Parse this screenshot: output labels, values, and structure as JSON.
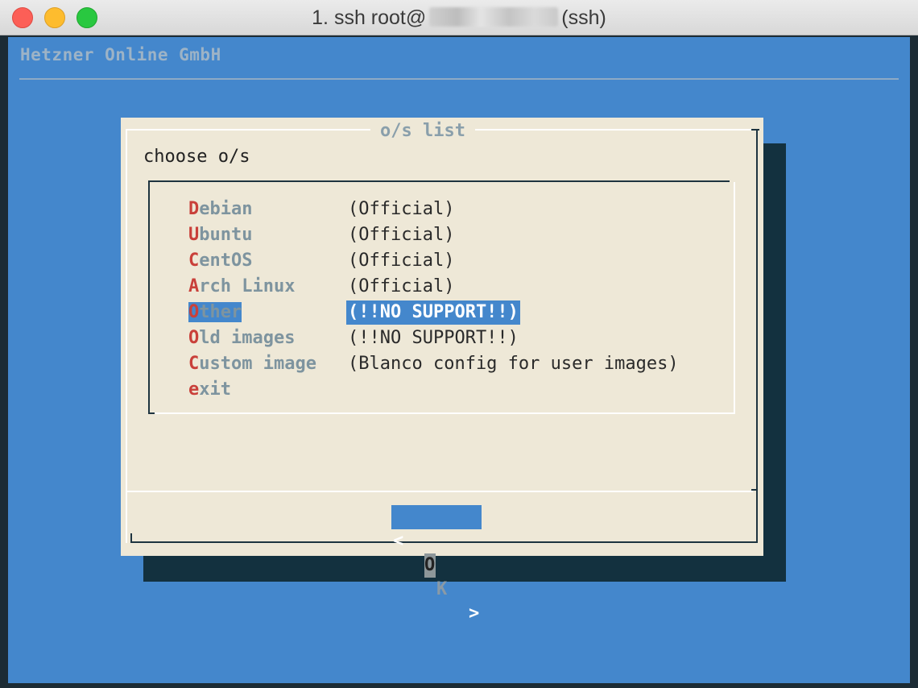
{
  "window": {
    "title_prefix": "1. ssh root@",
    "title_suffix": "(ssh)"
  },
  "terminal": {
    "backtitle": "Hetzner Online GmbH"
  },
  "dialog": {
    "title": "o/s list",
    "prompt": "choose o/s",
    "items": [
      {
        "hotkey": "D",
        "rest": "ebian",
        "desc": "(Official)"
      },
      {
        "hotkey": "U",
        "rest": "buntu",
        "desc": "(Official)"
      },
      {
        "hotkey": "C",
        "rest": "entOS",
        "desc": "(Official)"
      },
      {
        "hotkey": "A",
        "rest": "rch Linux",
        "desc": "(Official)"
      },
      {
        "hotkey": "O",
        "rest": "ther",
        "desc": "(!!NO SUPPORT!!)"
      },
      {
        "hotkey": "O",
        "rest": "ld images",
        "desc": "(!!NO SUPPORT!!)"
      },
      {
        "hotkey": "C",
        "rest": "ustom image",
        "desc": "(Blanco config for user images)"
      },
      {
        "hotkey": "e",
        "rest": "xit",
        "desc": ""
      }
    ],
    "selected_index": 4,
    "ok_button": {
      "left_bracket": "<",
      "hotkey": "O",
      "rest": "K",
      "right_bracket": ">"
    }
  },
  "colors": {
    "terminal_bg": "#4487cc",
    "dialog_bg": "#eee8d7",
    "shadow": "#13313f",
    "hotkey": "#c9403a",
    "highlight": "#4487cc"
  }
}
